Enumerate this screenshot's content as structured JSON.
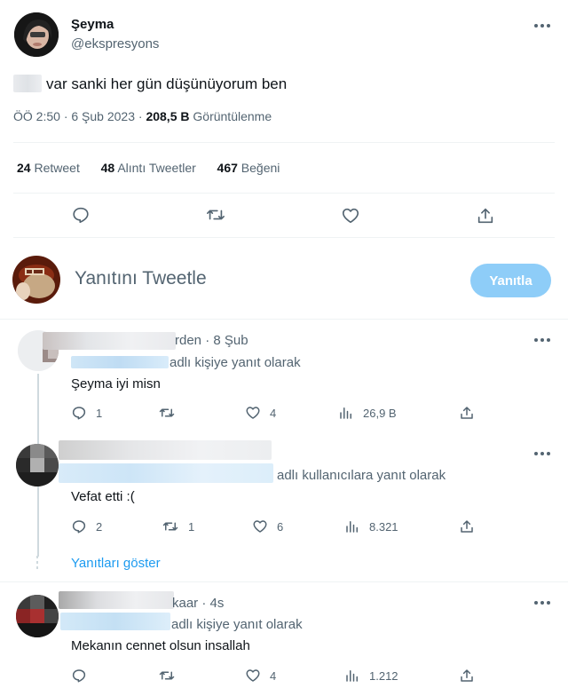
{
  "tweet": {
    "author_name": "Şeyma",
    "author_handle": "@ekspresyons",
    "text": "var sanki her gün düşünüyorum ben",
    "time": "ÖÖ 2:50",
    "date": "6 Şub 2023",
    "views_count": "208,5 B",
    "views_label": "Görüntülenme",
    "stats": {
      "retweets_count": "24",
      "retweets_label": "Retweet",
      "quotes_count": "48",
      "quotes_label": "Alıntı Tweetler",
      "likes_count": "467",
      "likes_label": "Beğeni"
    }
  },
  "reply_box": {
    "placeholder": "Yanıtını Tweetle",
    "button_label": "Yanıtla"
  },
  "replies": [
    {
      "name_suffix": "rden",
      "time": "8 Şub",
      "reply_to": "adlı kişiye yanıt olarak",
      "text": "Şeyma iyi misn",
      "reply_count": "1",
      "retweet_count": "",
      "like_count": "4",
      "view_count": "26,9 B"
    },
    {
      "name_suffix": "",
      "time": "",
      "reply_to": "adlı kullanıcılara yanıt olarak",
      "text": "Vefat etti :(",
      "reply_count": "2",
      "retweet_count": "1",
      "like_count": "6",
      "view_count": "8.321"
    },
    {
      "name_suffix": "kaar",
      "time": "4s",
      "reply_to": "adlı kişiye yanıt olarak",
      "text": "Mekanın cennet olsun insallah",
      "reply_count": "",
      "retweet_count": "",
      "like_count": "4",
      "view_count": "1.212"
    }
  ],
  "show_replies_label": "Yanıtları göster",
  "colors": {
    "accent": "#1d9bf0",
    "accent_disabled": "#8ecdf8",
    "text": "#0f1419",
    "muted": "#536471",
    "divider": "#eff3f4"
  }
}
